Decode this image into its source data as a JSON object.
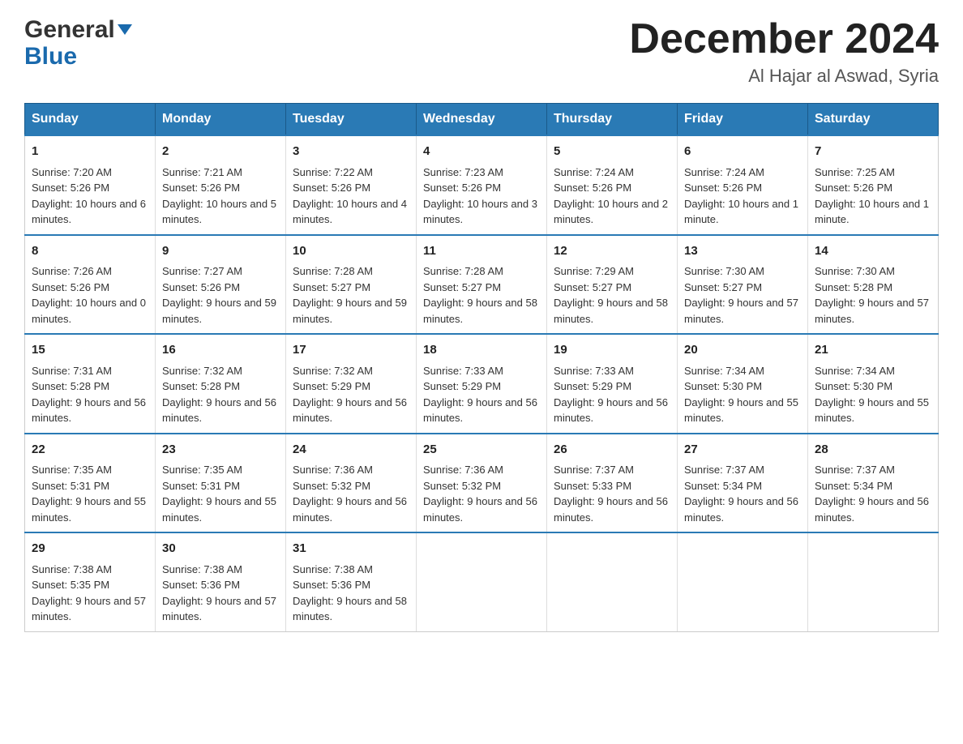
{
  "header": {
    "logo_general": "General",
    "logo_blue": "Blue",
    "month_title": "December 2024",
    "location": "Al Hajar al Aswad, Syria"
  },
  "days_of_week": [
    "Sunday",
    "Monday",
    "Tuesday",
    "Wednesday",
    "Thursday",
    "Friday",
    "Saturday"
  ],
  "weeks": [
    [
      {
        "day": "1",
        "sunrise": "7:20 AM",
        "sunset": "5:26 PM",
        "daylight": "10 hours and 6 minutes."
      },
      {
        "day": "2",
        "sunrise": "7:21 AM",
        "sunset": "5:26 PM",
        "daylight": "10 hours and 5 minutes."
      },
      {
        "day": "3",
        "sunrise": "7:22 AM",
        "sunset": "5:26 PM",
        "daylight": "10 hours and 4 minutes."
      },
      {
        "day": "4",
        "sunrise": "7:23 AM",
        "sunset": "5:26 PM",
        "daylight": "10 hours and 3 minutes."
      },
      {
        "day": "5",
        "sunrise": "7:24 AM",
        "sunset": "5:26 PM",
        "daylight": "10 hours and 2 minutes."
      },
      {
        "day": "6",
        "sunrise": "7:24 AM",
        "sunset": "5:26 PM",
        "daylight": "10 hours and 1 minute."
      },
      {
        "day": "7",
        "sunrise": "7:25 AM",
        "sunset": "5:26 PM",
        "daylight": "10 hours and 1 minute."
      }
    ],
    [
      {
        "day": "8",
        "sunrise": "7:26 AM",
        "sunset": "5:26 PM",
        "daylight": "10 hours and 0 minutes."
      },
      {
        "day": "9",
        "sunrise": "7:27 AM",
        "sunset": "5:26 PM",
        "daylight": "9 hours and 59 minutes."
      },
      {
        "day": "10",
        "sunrise": "7:28 AM",
        "sunset": "5:27 PM",
        "daylight": "9 hours and 59 minutes."
      },
      {
        "day": "11",
        "sunrise": "7:28 AM",
        "sunset": "5:27 PM",
        "daylight": "9 hours and 58 minutes."
      },
      {
        "day": "12",
        "sunrise": "7:29 AM",
        "sunset": "5:27 PM",
        "daylight": "9 hours and 58 minutes."
      },
      {
        "day": "13",
        "sunrise": "7:30 AM",
        "sunset": "5:27 PM",
        "daylight": "9 hours and 57 minutes."
      },
      {
        "day": "14",
        "sunrise": "7:30 AM",
        "sunset": "5:28 PM",
        "daylight": "9 hours and 57 minutes."
      }
    ],
    [
      {
        "day": "15",
        "sunrise": "7:31 AM",
        "sunset": "5:28 PM",
        "daylight": "9 hours and 56 minutes."
      },
      {
        "day": "16",
        "sunrise": "7:32 AM",
        "sunset": "5:28 PM",
        "daylight": "9 hours and 56 minutes."
      },
      {
        "day": "17",
        "sunrise": "7:32 AM",
        "sunset": "5:29 PM",
        "daylight": "9 hours and 56 minutes."
      },
      {
        "day": "18",
        "sunrise": "7:33 AM",
        "sunset": "5:29 PM",
        "daylight": "9 hours and 56 minutes."
      },
      {
        "day": "19",
        "sunrise": "7:33 AM",
        "sunset": "5:29 PM",
        "daylight": "9 hours and 56 minutes."
      },
      {
        "day": "20",
        "sunrise": "7:34 AM",
        "sunset": "5:30 PM",
        "daylight": "9 hours and 55 minutes."
      },
      {
        "day": "21",
        "sunrise": "7:34 AM",
        "sunset": "5:30 PM",
        "daylight": "9 hours and 55 minutes."
      }
    ],
    [
      {
        "day": "22",
        "sunrise": "7:35 AM",
        "sunset": "5:31 PM",
        "daylight": "9 hours and 55 minutes."
      },
      {
        "day": "23",
        "sunrise": "7:35 AM",
        "sunset": "5:31 PM",
        "daylight": "9 hours and 55 minutes."
      },
      {
        "day": "24",
        "sunrise": "7:36 AM",
        "sunset": "5:32 PM",
        "daylight": "9 hours and 56 minutes."
      },
      {
        "day": "25",
        "sunrise": "7:36 AM",
        "sunset": "5:32 PM",
        "daylight": "9 hours and 56 minutes."
      },
      {
        "day": "26",
        "sunrise": "7:37 AM",
        "sunset": "5:33 PM",
        "daylight": "9 hours and 56 minutes."
      },
      {
        "day": "27",
        "sunrise": "7:37 AM",
        "sunset": "5:34 PM",
        "daylight": "9 hours and 56 minutes."
      },
      {
        "day": "28",
        "sunrise": "7:37 AM",
        "sunset": "5:34 PM",
        "daylight": "9 hours and 56 minutes."
      }
    ],
    [
      {
        "day": "29",
        "sunrise": "7:38 AM",
        "sunset": "5:35 PM",
        "daylight": "9 hours and 57 minutes."
      },
      {
        "day": "30",
        "sunrise": "7:38 AM",
        "sunset": "5:36 PM",
        "daylight": "9 hours and 57 minutes."
      },
      {
        "day": "31",
        "sunrise": "7:38 AM",
        "sunset": "5:36 PM",
        "daylight": "9 hours and 58 minutes."
      },
      null,
      null,
      null,
      null
    ]
  ]
}
